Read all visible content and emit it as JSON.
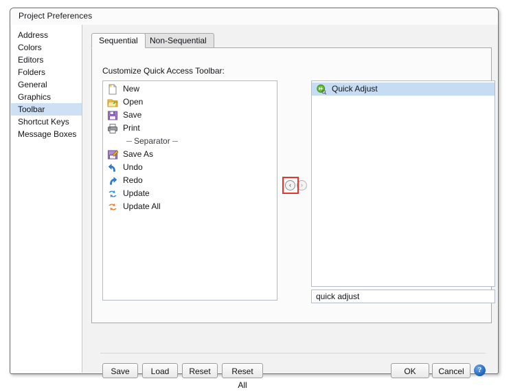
{
  "window": {
    "title": "Project Preferences"
  },
  "sidebar": {
    "items": [
      {
        "label": "Address",
        "selected": false
      },
      {
        "label": "Colors",
        "selected": false
      },
      {
        "label": "Editors",
        "selected": false
      },
      {
        "label": "Folders",
        "selected": false
      },
      {
        "label": "General",
        "selected": false
      },
      {
        "label": "Graphics",
        "selected": false
      },
      {
        "label": "Toolbar",
        "selected": true
      },
      {
        "label": "Shortcut Keys",
        "selected": false
      },
      {
        "label": "Message Boxes",
        "selected": false
      }
    ],
    "selected_label": "Toolbar",
    "selection_color": "#cde0f4"
  },
  "tabs": [
    {
      "label": "Sequential",
      "active": true
    },
    {
      "label": "Non-Sequential",
      "active": false
    }
  ],
  "main": {
    "customize_label": "Customize Quick Access Toolbar:",
    "available_items": [
      {
        "label": "New",
        "icon": "new-document-icon"
      },
      {
        "label": "Open",
        "icon": "open-folder-icon"
      },
      {
        "label": "Save",
        "icon": "floppy-disk-icon"
      },
      {
        "label": "Print",
        "icon": "printer-icon"
      },
      {
        "label": "Separator",
        "icon": "separator-icon"
      },
      {
        "label": "Save As",
        "icon": "save-as-icon"
      },
      {
        "label": "Undo",
        "icon": "undo-arrow-icon"
      },
      {
        "label": "Redo",
        "icon": "redo-arrow-icon"
      },
      {
        "label": "Update",
        "icon": "update-refresh-icon"
      },
      {
        "label": "Update All",
        "icon": "update-all-refresh-icon"
      }
    ],
    "selected_items": [
      {
        "label": "Quick Adjust",
        "icon": "quick-adjust-icon",
        "selected": true
      }
    ],
    "move_left_label": "‹",
    "move_right_label": "›",
    "highlight_color": "#e8342b",
    "name_field_value": "quick adjust",
    "name_field_placeholder": ""
  },
  "footer": {
    "save_label": "Save",
    "load_label": "Load",
    "reset_label": "Reset",
    "reset_all_label": "Reset All",
    "ok_label": "OK",
    "cancel_label": "Cancel",
    "help_label": "?"
  }
}
